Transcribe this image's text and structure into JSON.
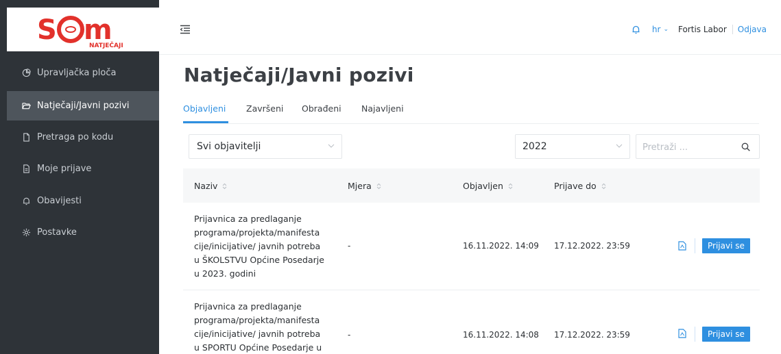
{
  "brand": {
    "logo_text": "SOM",
    "logo_subtext": "NATJEČAJI",
    "brand_color": "#e2312b"
  },
  "sidebar": {
    "items": [
      {
        "label": "Upravljačka ploča",
        "icon": "pie-chart-icon",
        "active": false
      },
      {
        "label": "Natječaji/Javni pozivi",
        "icon": "folder-open-icon",
        "active": true
      },
      {
        "label": "Pretraga po kodu",
        "icon": "file-icon",
        "active": false
      },
      {
        "label": "Moje prijave",
        "icon": "file-text-icon",
        "active": false
      },
      {
        "label": "Obavijesti",
        "icon": "bell-icon",
        "active": false
      },
      {
        "label": "Postavke",
        "icon": "gear-icon",
        "active": false
      }
    ]
  },
  "header": {
    "language": "hr",
    "user": "Fortis Labor",
    "logout": "Odjava"
  },
  "main": {
    "title": "Natječaji/Javni pozivi",
    "tabs": [
      {
        "label": "Objavljeni",
        "active": true
      },
      {
        "label": "Završeni",
        "active": false
      },
      {
        "label": "Obrađeni",
        "active": false
      },
      {
        "label": "Najavljeni",
        "active": false
      }
    ],
    "filters": {
      "publisher": "Svi objavitelji",
      "year": "2022",
      "search_placeholder": "Pretraži ..."
    },
    "table": {
      "columns": [
        "Naziv",
        "Mjera",
        "Objavljen",
        "Prijave do"
      ],
      "rows": [
        {
          "name_lines": [
            "Prijavnica za predlaganje",
            "programa/projekta/manifesta",
            "cije/inicijative/ javnih potreba",
            "u ŠKOLSTVU Općine Posedarje",
            "u 2023. godini"
          ],
          "measure": "-",
          "published": "16.11.2022. 14:09",
          "deadline": "17.12.2022. 23:59",
          "action": "Prijavi se"
        },
        {
          "name_lines": [
            "Prijavnica za predlaganje",
            "programa/projekta/manifesta",
            "cije/inicijative/ javnih potreba",
            "u SPORTU Općine Posedarje u"
          ],
          "measure": "-",
          "published": "16.11.2022. 14:08",
          "deadline": "17.12.2022. 23:59",
          "action": "Prijavi se"
        }
      ]
    }
  },
  "colors": {
    "sidebar_bg": "#2e3338",
    "sidebar_active": "#4e555c",
    "accent": "#2e8fe0"
  }
}
